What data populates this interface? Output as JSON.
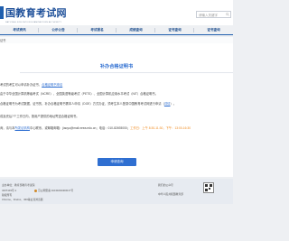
{
  "header": {
    "logo_text": "国教育考试网",
    "logo_sub": "NATIONAL EDUCATION EXAMINATIONS AUTHORITY",
    "search_placeholder": "请输入关键字"
  },
  "nav": {
    "items": [
      "考试资讯",
      "公示公告",
      "考试报名",
      "成绩查询",
      "证书查询",
      "证书查询"
    ]
  },
  "breadcrumb": "证书",
  "content": {
    "title": "补办合格证明书",
    "p1_text": "考试的考生可以申请补办证书、",
    "p1_link": "合格证明书申请",
    "p2": "由于中华全国计算机等级考试（NCRE）、全国英语等级考试（PETS）、全国计算机应用水平考试（NIT）合格证明书。",
    "p3": "合格证明书为考试数据，证书的，补办合格证明书需本人申请（DOE）方式办证，须考生本人登录中国教育考试网进行申请（",
    "p3_link": "详情",
    "p3_end": "）。",
    "p4": "成及完后7个工作日内，按用户提供的地址寄送合格证明书。",
    "p5_start": "询，请与本",
    "p5_link": "所发证机构",
    "p5_mid": "中心联系，或邮箱邮箱：jiaoyu@mail.neea.edu.cn；电话：010-82693000；",
    "p5_hours": "工作日：上午 8:30-11:30，下午：13:00-16:30",
    "button_label": "申请查询"
  },
  "footer": {
    "line1": "主办单位：教育部教育考试院",
    "line2": "4337103号-1",
    "line3": "京公网安备 11040202400017号",
    "line4": "版权所有",
    "line5": "Chrome、Firefox、360等主流浏览器",
    "line6": "我们的公众号",
    "line7": "中华人民共和国教育部"
  }
}
